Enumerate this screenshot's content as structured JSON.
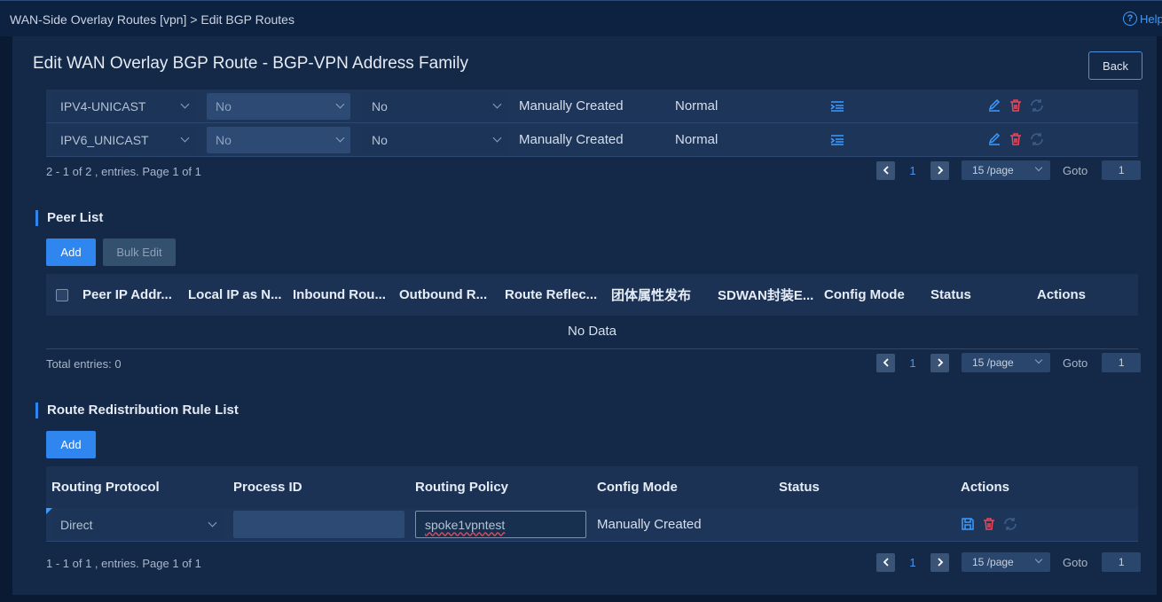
{
  "header": {
    "breadcrumb": "WAN-Side Overlay Routes [vpn] > Edit BGP Routes",
    "help_label": "Help"
  },
  "page": {
    "title": "Edit WAN Overlay BGP Route - BGP-VPN Address Family",
    "back_label": "Back"
  },
  "address_family_table": {
    "rows": [
      {
        "family": "IPV4-UNICAST",
        "opt1": "No",
        "opt2": "No",
        "config_mode": "Manually Created",
        "status": "Normal"
      },
      {
        "family": "IPV6_UNICAST",
        "opt1": "No",
        "opt2": "No",
        "config_mode": "Manually Created",
        "status": "Normal"
      }
    ],
    "summary": "2 - 1 of 2 , entries. Page 1 of 1",
    "pager": {
      "page": "1",
      "page_size": "15 /page",
      "goto_label": "Goto",
      "goto_value": "1"
    }
  },
  "peer_list": {
    "title": "Peer List",
    "add_label": "Add",
    "bulk_edit_label": "Bulk Edit",
    "columns": [
      "Peer IP Addr...",
      "Local IP as N...",
      "Inbound Rou...",
      "Outbound R...",
      "Route Reflec...",
      "团体属性发布",
      "SDWAN封装E...",
      "Config Mode",
      "Status",
      "Actions"
    ],
    "no_data": "No Data",
    "summary": "Total entries: 0",
    "pager": {
      "page": "1",
      "page_size": "15 /page",
      "goto_label": "Goto",
      "goto_value": "1"
    }
  },
  "redistribution": {
    "title": "Route Redistribution Rule List",
    "add_label": "Add",
    "columns": [
      "Routing Protocol",
      "Process ID",
      "Routing Policy",
      "Config Mode",
      "Status",
      "Actions"
    ],
    "row": {
      "protocol": "Direct",
      "process_id": "",
      "policy": "spoke1vpntest",
      "config_mode": "Manually Created",
      "status": ""
    },
    "summary": "1 - 1 of 1 , entries. Page 1 of 1",
    "pager": {
      "page": "1",
      "page_size": "15 /page",
      "goto_label": "Goto",
      "goto_value": "1"
    }
  },
  "colors": {
    "accent": "#2f86ef",
    "delete": "#e5475b",
    "panel": "#142847"
  }
}
